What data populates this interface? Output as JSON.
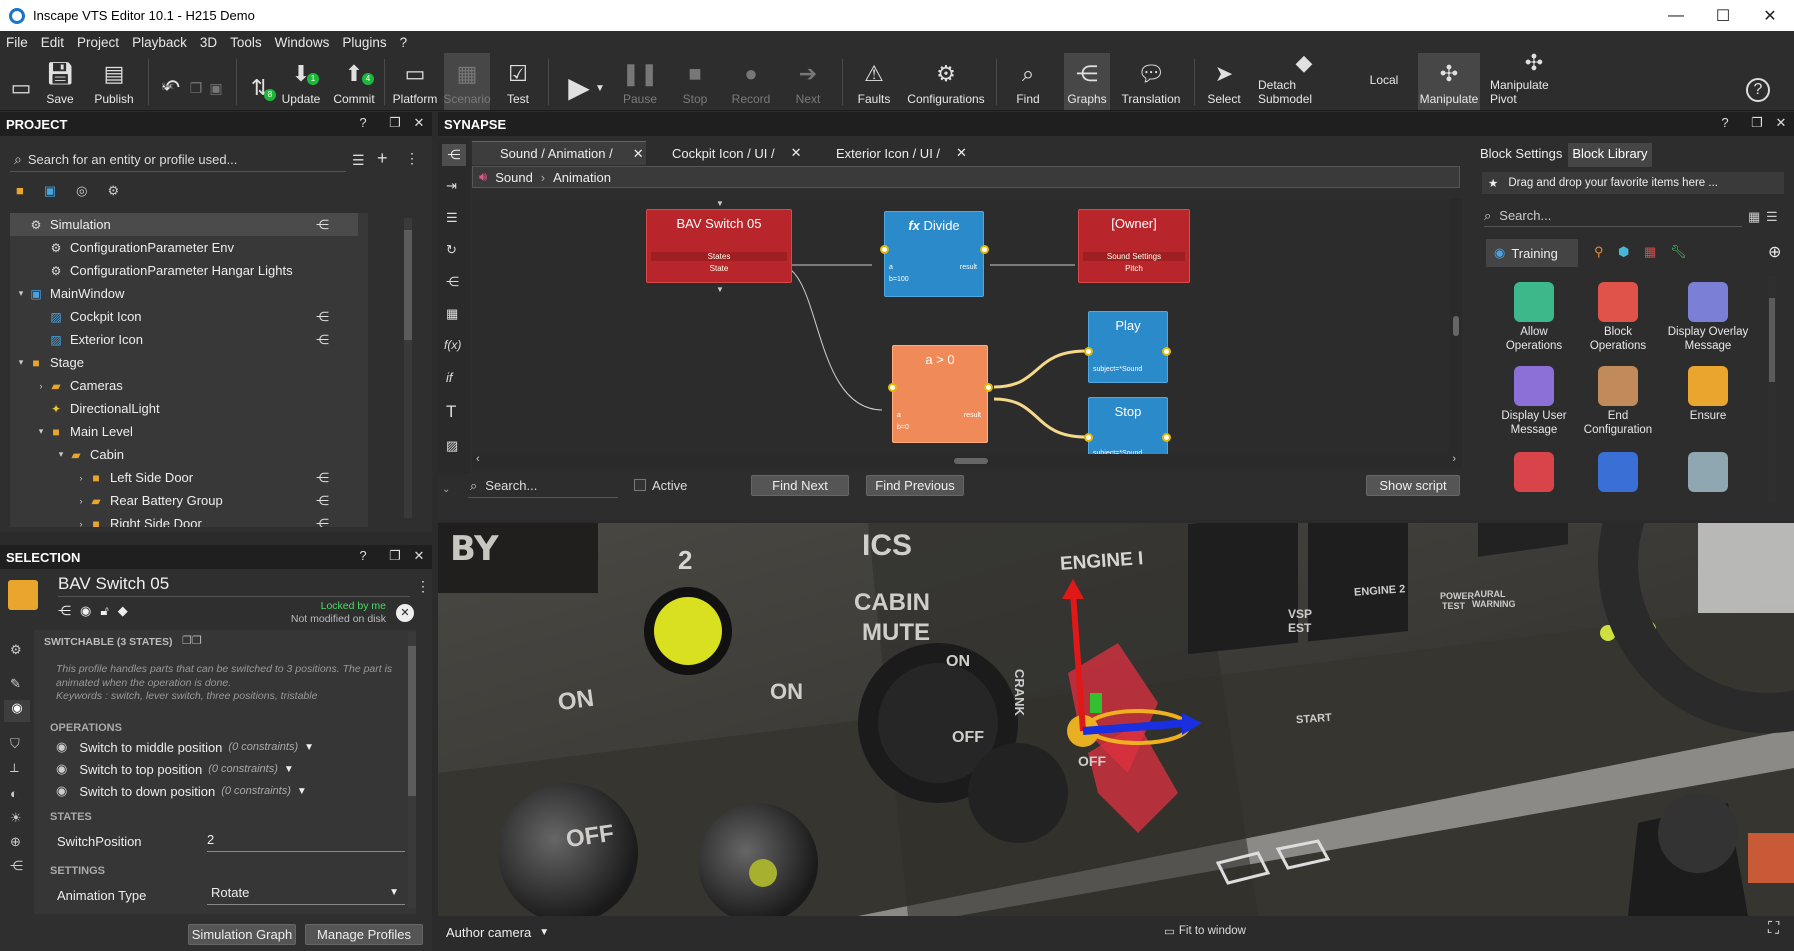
{
  "window": {
    "title": "Inscape VTS Editor 10.1 - H215 Demo"
  },
  "menu": [
    "File",
    "Edit",
    "Project",
    "Playback",
    "3D",
    "Tools",
    "Windows",
    "Plugins",
    "?"
  ],
  "toolbar": {
    "save": "Save",
    "publish": "Publish",
    "update": "Update",
    "update_badge": "1",
    "commit": "Commit",
    "commit_badge": "4",
    "undo_badge": "8",
    "platform": "Platform",
    "scenario": "Scenario",
    "test": "Test",
    "pause": "Pause",
    "stop": "Stop",
    "record": "Record",
    "next": "Next",
    "faults": "Faults",
    "configurations": "Configurations",
    "find": "Find",
    "graphs": "Graphs",
    "translation": "Translation",
    "select": "Select",
    "detach": "Detach Submodel",
    "local": "Local",
    "manipulate": "Manipulate",
    "manipulate_pivot": "Manipulate Pivot"
  },
  "project": {
    "header": "PROJECT",
    "search_placeholder": "Search for an entity or profile used...",
    "tree": [
      {
        "label": "Simulation",
        "depth": 0,
        "arrow": "",
        "icon": "gear-icon"
      },
      {
        "label": "ConfigurationParameter Env",
        "depth": 1,
        "arrow": "",
        "icon": "gear-icon"
      },
      {
        "label": "ConfigurationParameter Hangar Lights",
        "depth": 1,
        "arrow": "",
        "icon": "gear-icon"
      },
      {
        "label": "MainWindow",
        "depth": 0,
        "arrow": "▾",
        "icon": "window-icon"
      },
      {
        "label": "Cockpit Icon",
        "depth": 1,
        "arrow": "",
        "icon": "image-icon"
      },
      {
        "label": "Exterior Icon",
        "depth": 1,
        "arrow": "",
        "icon": "image-icon"
      },
      {
        "label": "Stage",
        "depth": 0,
        "arrow": "▾",
        "icon": "stage-icon"
      },
      {
        "label": "Cameras",
        "depth": 1,
        "arrow": "›",
        "icon": "folder-icon"
      },
      {
        "label": "DirectionalLight",
        "depth": 1,
        "arrow": "",
        "icon": "light-icon"
      },
      {
        "label": "Main Level",
        "depth": 1,
        "arrow": "▾",
        "icon": "cube-icon"
      },
      {
        "label": "Cabin",
        "depth": 2,
        "arrow": "▾",
        "icon": "folder-icon"
      },
      {
        "label": "Left Side Door",
        "depth": 3,
        "arrow": "›",
        "icon": "cube-icon"
      },
      {
        "label": "Rear Battery Group",
        "depth": 3,
        "arrow": "›",
        "icon": "folder-icon"
      },
      {
        "label": "Right Side Door",
        "depth": 3,
        "arrow": "›",
        "icon": "cube-icon"
      }
    ]
  },
  "synapse": {
    "header": "SYNAPSE",
    "tabs": [
      "Sound / Animation /",
      "Cockpit Icon / UI /",
      "Exterior Icon / UI /"
    ],
    "breadcrumb": [
      "Sound",
      "Animation"
    ],
    "nodes": {
      "bav": {
        "title": "BAV Switch 05",
        "sub1": "States",
        "sub2": "State"
      },
      "divide": {
        "title": "Divide",
        "pin_a": "a",
        "pin_b": "b=100",
        "pin_r": "result"
      },
      "owner": {
        "title": "[Owner]",
        "sub1": "Sound Settings",
        "sub2": "Pitch"
      },
      "compare": {
        "title": "a > 0",
        "pin_a": "a",
        "pin_b": "b=0",
        "pin_r": "result"
      },
      "play": {
        "title": "Play",
        "pin": "subject=*Sound"
      },
      "stop": {
        "title": "Stop",
        "pin": "subject=*Sound"
      }
    },
    "search_placeholder": "Search...",
    "active": "Active",
    "find_next": "Find Next",
    "find_prev": "Find Previous",
    "show_script": "Show script"
  },
  "library": {
    "tab_settings": "Block Settings",
    "tab_library": "Block Library",
    "fav_hint": "Drag and drop your favorite items here ...",
    "search_placeholder": "Search...",
    "category": "Training",
    "items": [
      {
        "label": "Allow\nOperations",
        "color": "#3db88a"
      },
      {
        "label": "Block\nOperations",
        "color": "#e0534a"
      },
      {
        "label": "Display Overlay\nMessage",
        "color": "#7b7fd6"
      },
      {
        "label": "Display User\nMessage",
        "color": "#8d6fd8"
      },
      {
        "label": "End\nConfiguration",
        "color": "#c08a5a"
      },
      {
        "label": "Ensure",
        "color": "#e9a52d"
      }
    ]
  },
  "selection": {
    "header": "SELECTION",
    "name": "BAV Switch 05",
    "locked": "Locked by me",
    "modified": "Not modified on disk",
    "profile": "SWITCHABLE (3 STATES)",
    "description": "This profile handles parts that can be switched to 3 positions. The part is animated when the operation is done.",
    "keywords": "Keywords : switch, lever switch, three positions, tristable",
    "operations_label": "OPERATIONS",
    "operations": [
      {
        "label": "Switch to middle position",
        "c": "(0 constraints)"
      },
      {
        "label": "Switch to top position",
        "c": "(0 constraints)"
      },
      {
        "label": "Switch to down position",
        "c": "(0 constraints)"
      }
    ],
    "states_label": "STATES",
    "switch_pos_label": "SwitchPosition",
    "switch_pos_value": "2",
    "settings_label": "SETTINGS",
    "anim_type_label": "Animation Type",
    "anim_type_value": "Rotate",
    "sim_graph": "Simulation Graph",
    "manage_profiles": "Manage Profiles"
  },
  "viewport": {
    "camera": "Author camera",
    "fit": "Fit to window",
    "labels": {
      "by": "BY",
      "two": "2",
      "ics": "ICS",
      "cabin": "CABIN",
      "mute": "MUTE",
      "on1": "ON",
      "on2": "ON",
      "on3": "ON",
      "off1": "OFF",
      "off2": "OFF",
      "off3": "OFF",
      "engine1": "ENGINE I",
      "engine2": "ENGINE 2",
      "crank": "CRANK",
      "vsp": "VSP",
      "est": "EST",
      "start": "START",
      "power": "POWER",
      "test": "TEST",
      "aural": "AURAL",
      "warning": "WARNING"
    }
  }
}
